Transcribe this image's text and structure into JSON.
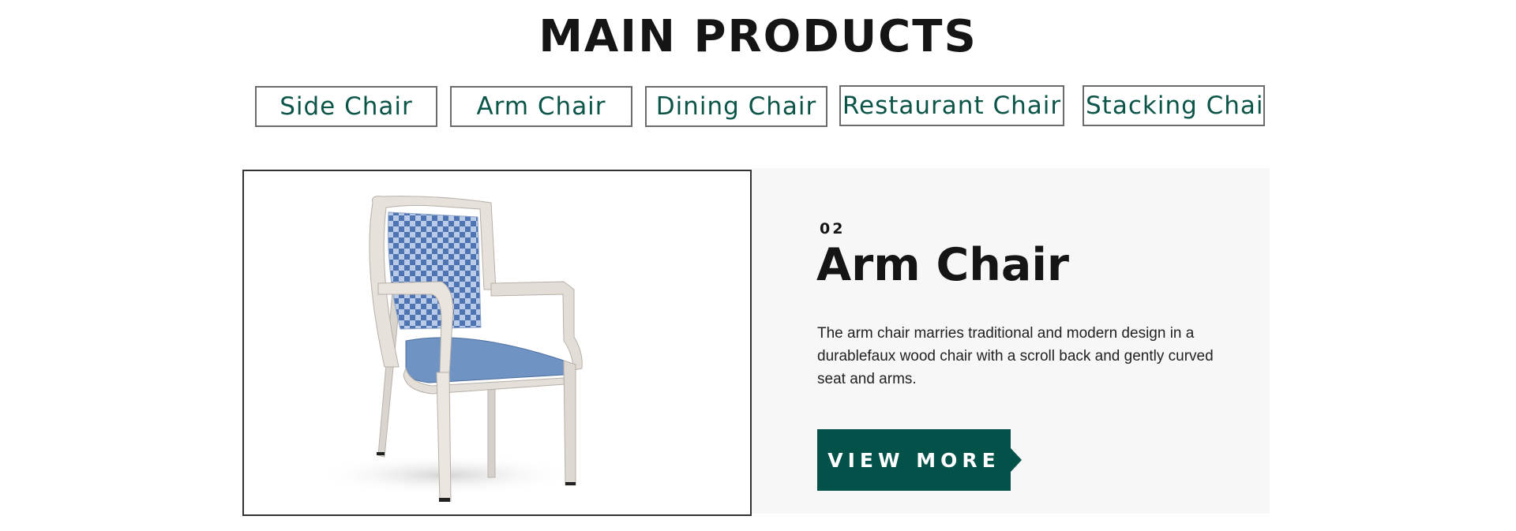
{
  "section": {
    "title": "MAIN PRODUCTS"
  },
  "tabs": [
    {
      "label": "Side Chair"
    },
    {
      "label": "Arm Chair"
    },
    {
      "label": "Dining Chair"
    },
    {
      "label": "Restaurant Chair"
    },
    {
      "label": "Stacking Chair"
    }
  ],
  "product": {
    "number": "02",
    "name": "Arm Chair",
    "description": "The arm chair marries traditional and modern design in a durablefaux wood chair with a scroll back and gently curved seat and arms.",
    "cta_label": "VIEW MORE",
    "image": "arm-chair-photo"
  },
  "colors": {
    "accent": "#02524a",
    "tab_text": "#0b5548",
    "panel_bg": "#f7f7f7",
    "seat": "#6f93c2"
  }
}
